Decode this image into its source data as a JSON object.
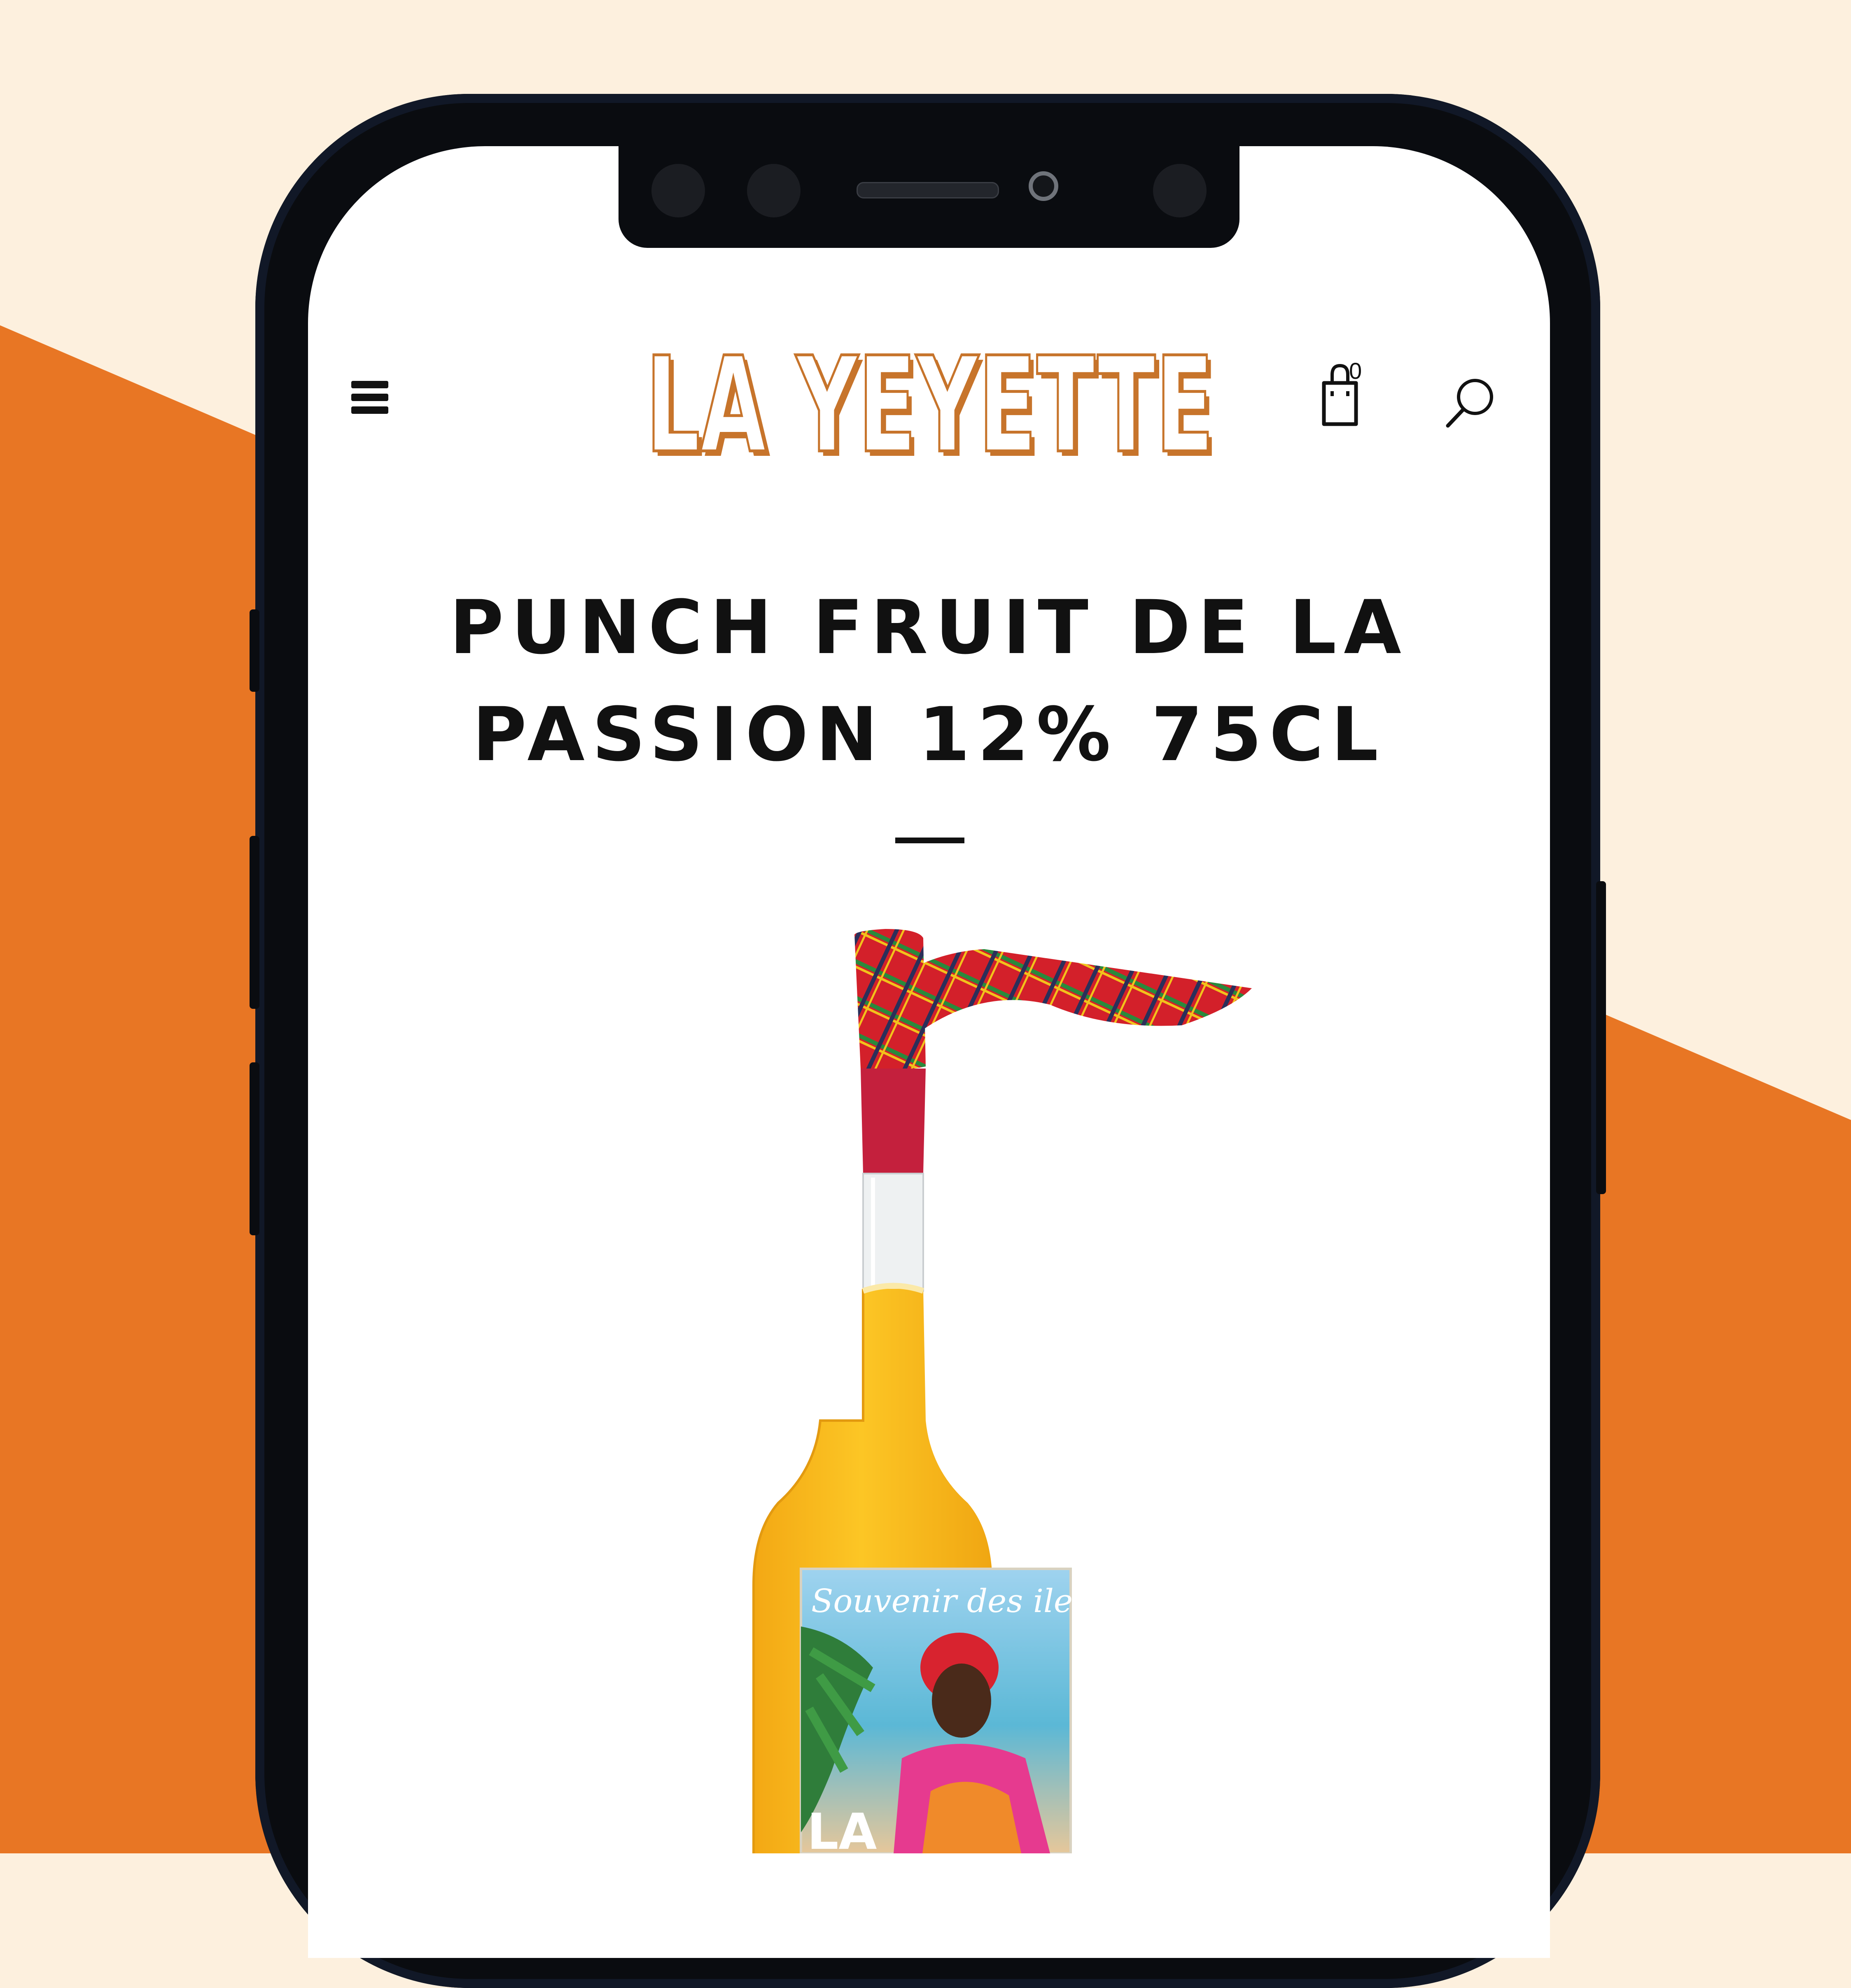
{
  "colors": {
    "background_cream": "#fdf0de",
    "background_orange": "#e87624",
    "phone_frame": "#0a0c10",
    "logo_orange": "#c7742b",
    "text_dark": "#111111"
  },
  "header": {
    "menu_icon": "hamburger-menu-icon",
    "logo_text": "LA YEYETTE",
    "cart_icon": "shopping-bag-icon",
    "cart_count": "0",
    "search_icon": "search-icon"
  },
  "product": {
    "title_line1": "PUNCH FRUIT DE LA",
    "title_line2": "PASSION 12% 75CL",
    "image": {
      "label_script": "Souvenir des iles",
      "label_brand": "LA"
    }
  }
}
